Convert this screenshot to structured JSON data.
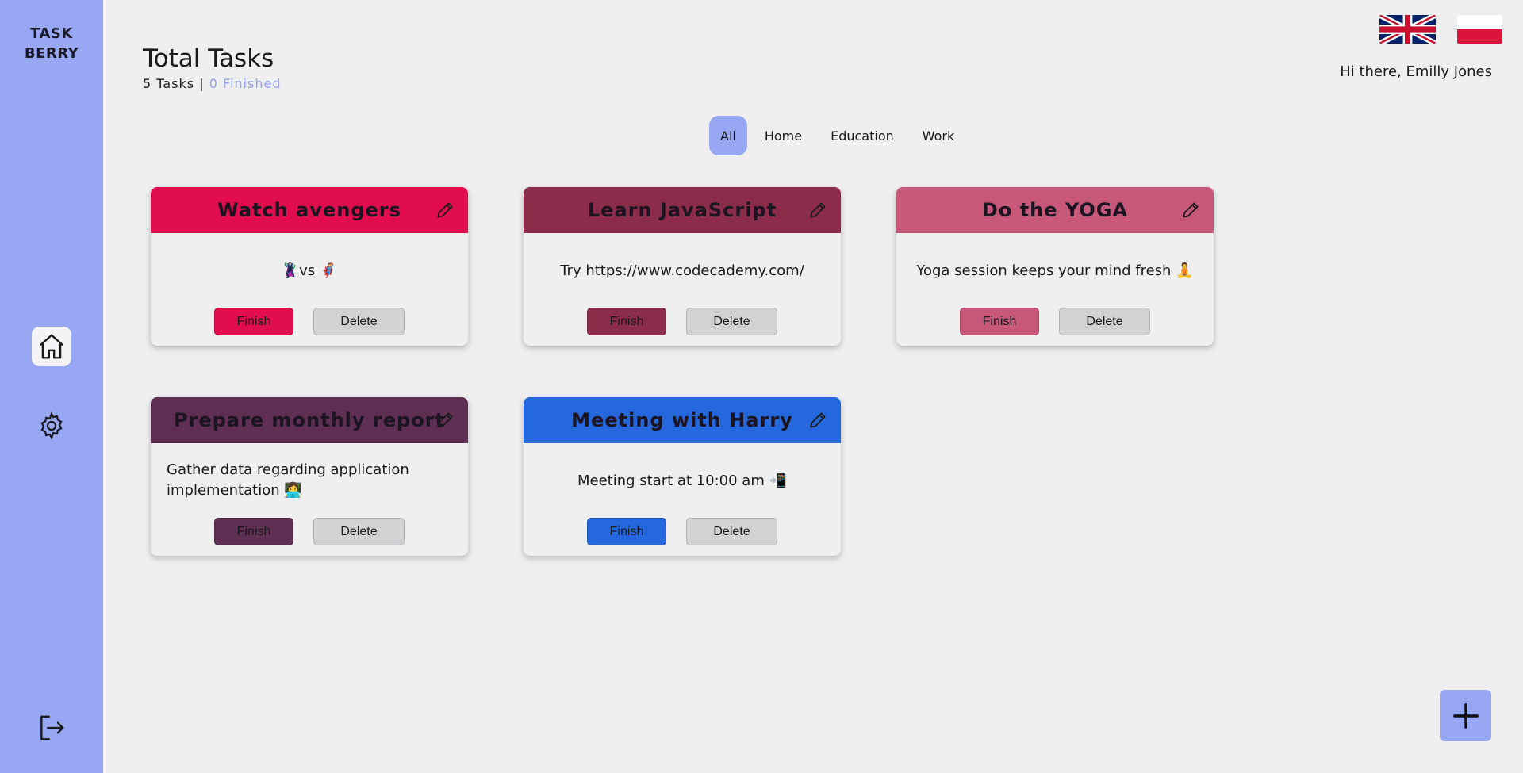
{
  "app": {
    "logo_line1": "TASK",
    "logo_line2": "BERRY"
  },
  "sidebar": {
    "items": [
      {
        "icon": "home-icon",
        "active": true
      },
      {
        "icon": "gear-icon",
        "active": false
      },
      {
        "icon": "logout-icon",
        "active": false
      }
    ]
  },
  "header": {
    "title": "Total Tasks",
    "tasks_count": "5 Tasks",
    "separator": " | ",
    "finished_count": "0 Finished",
    "greeting": "Hi there, Emilly Jones"
  },
  "languages": [
    "uk-flag",
    "poland-flag"
  ],
  "filters": [
    {
      "label": "All",
      "active": true
    },
    {
      "label": "Home",
      "active": false
    },
    {
      "label": "Education",
      "active": false
    },
    {
      "label": "Work",
      "active": false
    }
  ],
  "tasks": [
    {
      "title": "Watch avengers",
      "description": "🦹vs 🦸",
      "color": "#e20d4f",
      "finish_label": "Finish",
      "delete_label": "Delete"
    },
    {
      "title": "Learn JavaScript",
      "description": "Try https://www.codecademy.com/",
      "color": "#8b2c4b",
      "finish_label": "Finish",
      "delete_label": "Delete"
    },
    {
      "title": "Do the YOGA",
      "description": "Yoga session keeps your mind fresh 🧘",
      "color": "#c7587a",
      "finish_label": "Finish",
      "delete_label": "Delete"
    },
    {
      "title": "Prepare monthly report",
      "description": "Gather data regarding application implementation 👩‍💻",
      "color": "#5e2f53",
      "finish_label": "Finish",
      "delete_label": "Delete"
    },
    {
      "title": "Meeting with Harry",
      "description": "Meeting start at 10:00 am 📲",
      "color": "#2567dc",
      "finish_label": "Finish",
      "delete_label": "Delete"
    }
  ],
  "add_button": {
    "icon": "plus-icon"
  },
  "colors": {
    "sidebar": "#97a7f4",
    "background": "#efeff0",
    "accent": "#97a7f4"
  }
}
